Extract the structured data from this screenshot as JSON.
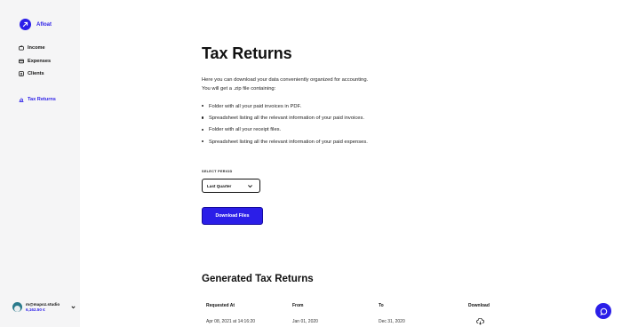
{
  "brand": {
    "name": "Afloat"
  },
  "sidebar": {
    "items": [
      {
        "label": "Income",
        "icon": "wallet-icon"
      },
      {
        "label": "Expenses",
        "icon": "card-icon"
      },
      {
        "label": "Clients",
        "icon": "contacts-icon"
      }
    ],
    "active": {
      "label": "Tax Returns",
      "icon": "chart-bars-icon"
    }
  },
  "account": {
    "email": "m@mapoz.studio",
    "balance": "6,162.50 €"
  },
  "main": {
    "title": "Tax Returns",
    "intro_line1": "Here you can download your data conveniently organized for accounting.",
    "intro_line2": "You will get a .zip file containing:",
    "bullets": [
      "Folder with all your paid invoices in PDF.",
      "Spreadsheet listing all the relevant information of your paid invoices.",
      "Folder with all your receipt files.",
      "Spreadsheet listing all the relevant information of your paid expenses."
    ],
    "period_label": "SELECT PERIOD",
    "period_value": "Last Quarter",
    "download_button": "Download Files",
    "generated_title": "Generated Tax Returns"
  },
  "table": {
    "columns": [
      "Requested At",
      "From",
      "To",
      "Download"
    ],
    "rows": [
      {
        "requested_at": "Apr 08, 2021 at 14:16:20",
        "from": "Jan 01, 2020",
        "to": "Dec 31, 2020"
      }
    ]
  },
  "colors": {
    "accent": "#2b1ee8",
    "sidebar_bg": "#f5f5f6"
  }
}
